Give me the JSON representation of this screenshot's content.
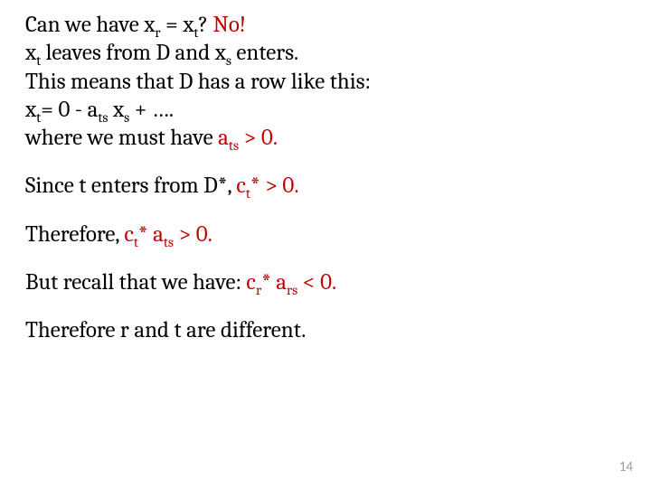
{
  "p1": {
    "a": "Can we have x",
    "b": " = x",
    "c": "?  ",
    "no": "No!"
  },
  "sub_r": "r",
  "sub_t": "t",
  "sub_s": "s",
  "sub_ts": "ts",
  "sub_rs": "rs",
  "p2": {
    "a": "x",
    "b": " leaves from D and x",
    "c": " enters."
  },
  "p3": "This means that D has a row like this:",
  "p4": {
    "a": "x",
    "b": "=   0  -  a",
    "c": " x",
    "d": " +  …."
  },
  "p5": {
    "a": "where we must have ",
    "b": "a",
    "c": " > 0."
  },
  "p6": {
    "a": "Since t  enters from D*, ",
    "b": "c",
    "c": "* > 0."
  },
  "p7": {
    "a": "Therefore, ",
    "b": "c",
    "c": "* a",
    "d": " > 0."
  },
  "p8": {
    "a": "But recall that we have: ",
    "b": "c",
    "c": "* a",
    "d": " < 0."
  },
  "p9": "Therefore r and t are different.",
  "page": "14"
}
